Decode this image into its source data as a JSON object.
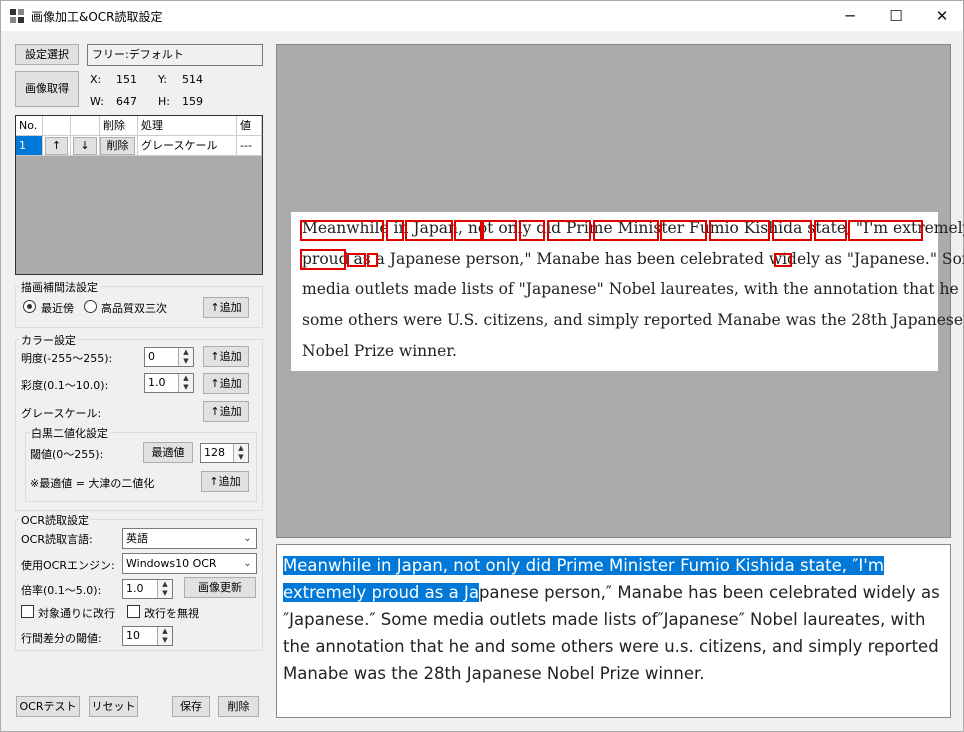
{
  "window": {
    "title": "画像加工&OCR読取設定",
    "minimize_glyph": "─",
    "maximize_glyph": "☐",
    "close_glyph": "✕"
  },
  "left": {
    "select_settings_label": "設定選択",
    "settings_value": "フリー:デフォルト",
    "capture_image_label": "画像取得",
    "x_label": "X:",
    "x_value": "151",
    "y_label": "Y:",
    "y_value": "514",
    "w_label": "W:",
    "w_value": "647",
    "h_label": "H:",
    "h_value": "159"
  },
  "grid": {
    "headers": [
      "No.",
      "",
      "",
      "削除",
      "処理",
      "値"
    ],
    "rows": [
      {
        "no": "1",
        "up": "↑",
        "down": "↓",
        "delete": "削除",
        "process": "グレースケール",
        "value": "---"
      }
    ]
  },
  "interp": {
    "title": "描画補間法設定",
    "option1": "最近傍",
    "option2": "高品質双三次",
    "selected": "最近傍",
    "add_label": "↑追加"
  },
  "color": {
    "title": "カラー設定",
    "brightness_label": "明度(-255〜255):",
    "brightness_value": "0",
    "saturation_label": "彩度(0.1〜10.0):",
    "saturation_value": "1.0",
    "grayscale_label": "グレースケール:",
    "add_label": "↑追加"
  },
  "binarize": {
    "title": "白黒二値化設定",
    "threshold_label": "閾値(0〜255):",
    "optimal_label": "最適値",
    "threshold_value": "128",
    "note": "※最適値 = 大津の二値化",
    "add_label": "↑追加"
  },
  "ocr": {
    "title": "OCR読取設定",
    "language_label": "OCR読取言語:",
    "language_value": "英語",
    "engine_label": "使用OCRエンジン:",
    "engine_value": "Windows10 OCR",
    "scale_label": "倍率(0.1〜5.0):",
    "scale_value": "1.0",
    "update_image_label": "画像更新",
    "newline_as_target_label": "対象通りに改行",
    "ignore_newline_label": "改行を無視",
    "line_gap_label": "行間差分の閾値:",
    "line_gap_value": "10"
  },
  "bottom": {
    "ocr_test_label": "OCRテスト",
    "reset_label": "リセット",
    "save_label": "保存",
    "delete_label": "削除"
  },
  "preview": {
    "lines": [
      "Meanwhile in Japan, not only did Prime Minister Fumio Kishida state, \"I'm extremely",
      "proud as a Japanese person,\" Manabe has been celebrated widely as \"Japanese.\" Some",
      "media outlets made lists of \"Japanese\" Nobel laureates, with the annotation that he and",
      "some others were U.S. citizens, and simply reported Manabe was the 28th Japanese",
      "Nobel Prize winner."
    ]
  },
  "result": {
    "selected_text": "Meanwhile in Japan, not only did Prime Minister Fumio Kishida state, ″I'm extremely proud as a Ja",
    "rest_text": "panese person,″ Manabe has been celebrated widely as ″Japanese.″ Some media outlets made lists of″Japanese″ Nobel laureates, with the annotation that he and some others were u.s. citizens, and simply reported Manabe was the 28th Japanese Nobel Prize winner."
  }
}
